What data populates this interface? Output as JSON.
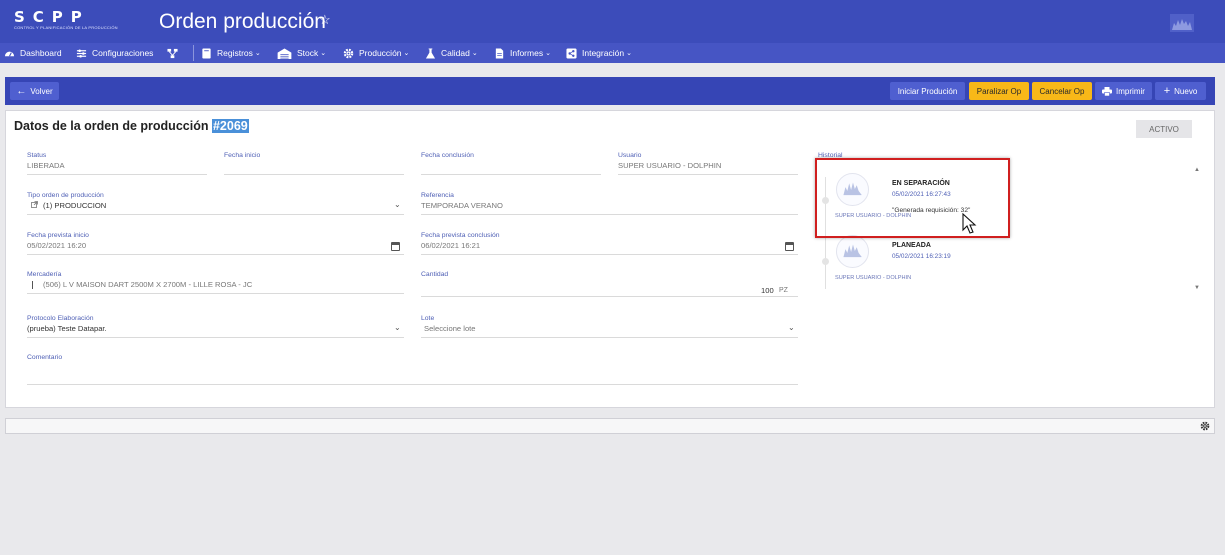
{
  "header": {
    "logo_text": "SCPP",
    "logo_subtitle": "CONTROL Y PLANIFICACIÓN DE LA PRODUCCIÓN",
    "title": "Orden producción",
    "star_icon": "star-outline-icon",
    "avatar_icon": "user-avatar-icon"
  },
  "nav": {
    "items": [
      {
        "label": "Dashboard",
        "icon": "dashboard-icon"
      },
      {
        "label": "Configuraciones",
        "icon": "sliders-icon"
      },
      {
        "label": "",
        "icon": "workflow-icon"
      },
      {
        "label": "Registros",
        "icon": "book-icon"
      },
      {
        "label": "Stock",
        "icon": "warehouse-icon"
      },
      {
        "label": "Producción",
        "icon": "gear-icon"
      },
      {
        "label": "Calidad",
        "icon": "flask-icon"
      },
      {
        "label": "Informes",
        "icon": "document-icon"
      },
      {
        "label": "Integración",
        "icon": "share-icon"
      }
    ]
  },
  "actions": {
    "back": "Volver",
    "start": "Iniciar Produción",
    "pause": "Paralizar Op",
    "cancel": "Cancelar Op",
    "print": "Imprimir",
    "new": "Nuevo"
  },
  "order": {
    "title": "Datos de la orden de producción",
    "number": "#2069",
    "state_badge": "ACTIVO"
  },
  "form": {
    "status": {
      "label": "Status",
      "value": "LIBERADA"
    },
    "fecha_inicio": {
      "label": "Fecha inicio",
      "value": ""
    },
    "fecha_conclusion": {
      "label": "Fecha conclusión",
      "value": ""
    },
    "usuario": {
      "label": "Usuario",
      "value": "SUPER USUARIO - DOLPHIN"
    },
    "tipo": {
      "label": "Tipo orden de producción",
      "value": "(1) PRODUCCION"
    },
    "referencia": {
      "label": "Referencia",
      "value": "TEMPORADA VERANO"
    },
    "prev_inicio": {
      "label": "Fecha prevista inicio",
      "value": "05/02/2021 16:20"
    },
    "prev_conclusion": {
      "label": "Fecha prevista conclusión",
      "value": "06/02/2021 16:21"
    },
    "mercaderia": {
      "label": "Mercadería",
      "value": "(506) L V MAISON DART 2500M X 2700M - LILLE ROSA - JC"
    },
    "cantidad": {
      "label": "Cantidad",
      "value": "100",
      "unit": "PZ"
    },
    "protocolo": {
      "label": "Protocolo Elaboración",
      "value": "(prueba) Teste Datapar."
    },
    "lote": {
      "label": "Lote",
      "placeholder": "Seleccione lote"
    },
    "comentario": {
      "label": "Comentario",
      "value": ""
    }
  },
  "history": {
    "label": "Historial",
    "entries": [
      {
        "title": "EN SEPARACIÓN",
        "date": "05/02/2021 16:27:43",
        "note": "\"Generada requisición: 32\"",
        "user": "SUPER USUARIO - DOLPHIN"
      },
      {
        "title": "PLANEADA",
        "date": "05/02/2021 16:23:19",
        "note": "",
        "user": "SUPER USUARIO - DOLPHIN"
      }
    ]
  },
  "colors": {
    "header": "#3c4cba",
    "nav": "#4655c4",
    "actionbar": "#3645b5",
    "accent_yellow": "#f8b818",
    "highlight_red": "#d01f1f"
  }
}
